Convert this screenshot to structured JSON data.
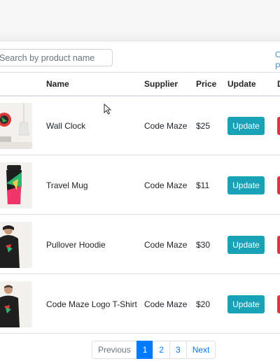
{
  "search": {
    "placeholder": "Search by product name"
  },
  "sort_links": [
    "O",
    "P"
  ],
  "table": {
    "headers": [
      "Name",
      "Supplier",
      "Price",
      "Update",
      "D"
    ],
    "rows": [
      {
        "name": "Wall Clock",
        "supplier": "Code Maze",
        "price": "$25",
        "update_label": "Update"
      },
      {
        "name": "Travel Mug",
        "supplier": "Code Maze",
        "price": "$11",
        "update_label": "Update"
      },
      {
        "name": "Pullover Hoodie",
        "supplier": "Code Maze",
        "price": "$30",
        "update_label": "Update"
      },
      {
        "name": "Code Maze Logo T-Shirt",
        "supplier": "Code Maze",
        "price": "$20",
        "update_label": "Update"
      }
    ]
  },
  "pagination": {
    "previous": "Previous",
    "pages": [
      "1",
      "2",
      "3"
    ],
    "active_page": "1",
    "next": "Next"
  },
  "colors": {
    "update_button": "#17a2b8",
    "delete_button": "#dc3545",
    "active_page": "#007bff",
    "link": "#4a90c9"
  }
}
